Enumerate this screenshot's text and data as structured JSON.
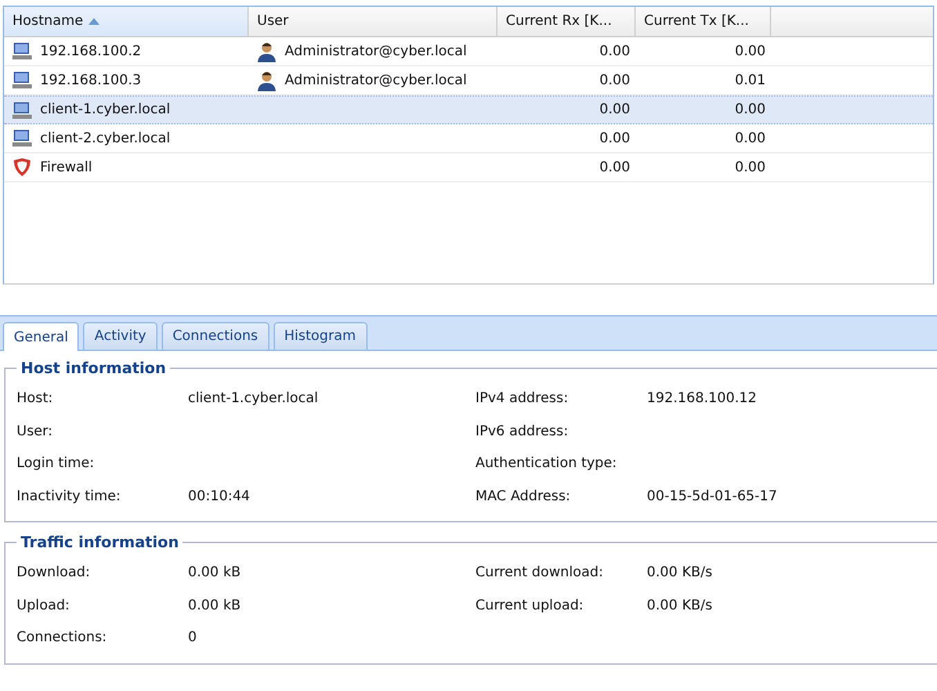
{
  "grid": {
    "columns": [
      {
        "label": "Hostname",
        "sorted": true
      },
      {
        "label": "User",
        "sorted": false
      },
      {
        "label": "Current Rx [K...",
        "sorted": false
      },
      {
        "label": "Current Tx [K...",
        "sorted": false
      }
    ],
    "rows": [
      {
        "kind": "computer",
        "hostname": "192.168.100.2",
        "user": "Administrator@cyber.local",
        "rx": "0.00",
        "tx": "0.00",
        "selected": false
      },
      {
        "kind": "computer",
        "hostname": "192.168.100.3",
        "user": "Administrator@cyber.local",
        "rx": "0.00",
        "tx": "0.01",
        "selected": false
      },
      {
        "kind": "computer",
        "hostname": "client-1.cyber.local",
        "rx": "0.00",
        "tx": "0.00",
        "selected": true
      },
      {
        "kind": "computer",
        "hostname": "client-2.cyber.local",
        "rx": "0.00",
        "tx": "0.00",
        "selected": false
      },
      {
        "kind": "firewall",
        "hostname": "Firewall",
        "rx": "0.00",
        "tx": "0.00",
        "selected": false
      }
    ]
  },
  "tabs": [
    {
      "label": "General",
      "selected": true
    },
    {
      "label": "Activity",
      "selected": false
    },
    {
      "label": "Connections",
      "selected": false
    },
    {
      "label": "Histogram",
      "selected": false
    }
  ],
  "sections": [
    {
      "title": "Host information",
      "rows": [
        {
          "label": "Host:",
          "value": "client-1.cyber.local",
          "label2": "IPv4 address:",
          "value2": "192.168.100.12"
        },
        {
          "label": "User:",
          "label2": "IPv6 address:"
        },
        {
          "label": "Login time:",
          "label2": "Authentication type:"
        },
        {
          "label": "Inactivity time:",
          "value": "00:10:44",
          "label2": "MAC Address:",
          "value2": "00-15-5d-01-65-17"
        }
      ]
    },
    {
      "title": "Traffic information",
      "rows": [
        {
          "label": "Download:",
          "value": "0.00 kB",
          "label2": "Current download:",
          "value2": "0.00 KB/s"
        },
        {
          "label": "Upload:",
          "value": "0.00 kB",
          "label2": "Current upload:",
          "value2": "0.00 KB/s"
        },
        {
          "label": "Connections:",
          "value": "0"
        }
      ]
    }
  ]
}
